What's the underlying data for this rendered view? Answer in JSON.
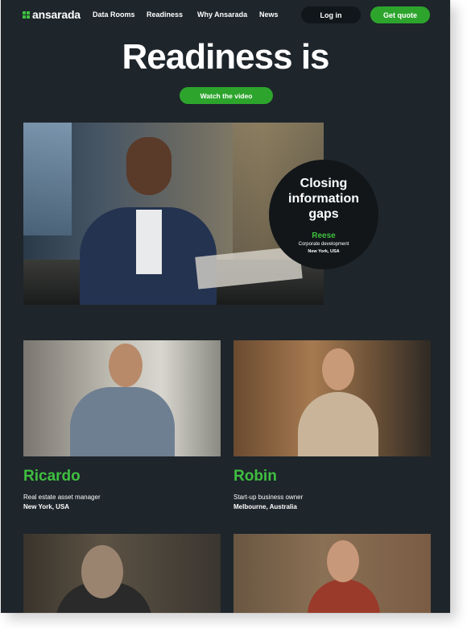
{
  "nav": {
    "brand": "ansarada",
    "links": [
      "Data Rooms",
      "Readiness",
      "Why Ansarada",
      "News"
    ],
    "login_label": "Log in",
    "quote_label": "Get quote"
  },
  "hero": {
    "title": "Readiness is",
    "video_label": "Watch the video",
    "feature": {
      "headline": "Closing information gaps",
      "name": "Reese",
      "role": "Corporate development",
      "location": "New York, USA"
    }
  },
  "people": [
    {
      "name": "Ricardo",
      "role": "Real estate asset manager",
      "location": "New York, USA"
    },
    {
      "name": "Robin",
      "role": "Start-up business owner",
      "location": "Melbourne, Australia"
    }
  ],
  "colors": {
    "accent": "#2da52d",
    "background": "#1e252b",
    "text": "#ffffff"
  }
}
